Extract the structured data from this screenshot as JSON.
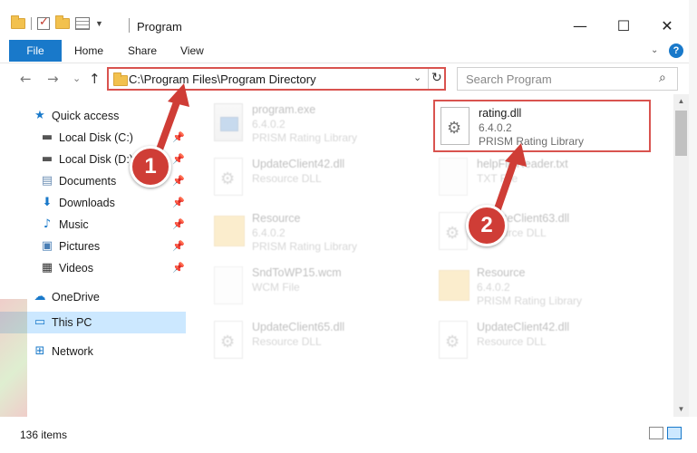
{
  "window": {
    "title": "Program",
    "minimize": "—",
    "maximize": "☐",
    "close": "✕"
  },
  "ribbon": {
    "tabs": [
      "File",
      "Home",
      "Share",
      "View"
    ],
    "help": "?"
  },
  "navbar": {
    "back": "←",
    "forward": "→",
    "recent": "⌄",
    "up": "↑",
    "address": "C:\\Program Files\\Program Directory",
    "refresh": "↻",
    "search_placeholder": "Search Program",
    "search_icon": "⌕"
  },
  "sidebar": {
    "items": [
      {
        "label": "Quick access",
        "icon": "star-icon"
      },
      {
        "label": "Local Disk (C:)",
        "icon": "drive-icon",
        "pinned": true
      },
      {
        "label": "Local Disk (D:)",
        "icon": "drive-icon",
        "pinned": true
      },
      {
        "label": "Documents",
        "icon": "documents-icon",
        "pinned": true
      },
      {
        "label": "Downloads",
        "icon": "download-icon",
        "pinned": true
      },
      {
        "label": "Music",
        "icon": "music-icon",
        "pinned": true
      },
      {
        "label": "Pictures",
        "icon": "pictures-icon",
        "pinned": true
      },
      {
        "label": "Videos",
        "icon": "videos-icon",
        "pinned": true
      },
      {
        "label": "OneDrive",
        "icon": "cloud-icon"
      },
      {
        "label": "This PC",
        "icon": "computer-icon",
        "selected": true
      },
      {
        "label": "Network",
        "icon": "network-icon"
      }
    ]
  },
  "files": [
    {
      "name": "program.exe",
      "line2": "6.4.0.2",
      "line3": "PRISM Rating Library",
      "type": "exe",
      "faded": true
    },
    {
      "name": "rating.dll",
      "line2": "6.4.0.2",
      "line3": "PRISM Rating Library",
      "type": "dll",
      "faded": false
    },
    {
      "name": "UpdateClient42.dll",
      "line2": "Resource DLL",
      "line3": "",
      "type": "dll",
      "faded": true
    },
    {
      "name": "helpFileReader.txt",
      "line2": "TXT File",
      "line3": "",
      "type": "txt",
      "faded": true
    },
    {
      "name": "Resource",
      "line2": "6.4.0.2",
      "line3": "PRISM Rating Library",
      "type": "folder",
      "faded": true
    },
    {
      "name": "UpdateClient63.dll",
      "line2": "Resource DLL",
      "line3": "",
      "type": "dll",
      "faded": true
    },
    {
      "name": "SndToWP15.wcm",
      "line2": "WCM File",
      "line3": "",
      "type": "txt",
      "faded": true
    },
    {
      "name": "Resource",
      "line2": "6.4.0.2",
      "line3": "PRISM Rating Library",
      "type": "folder",
      "faded": true
    },
    {
      "name": "UpdateClient65.dll",
      "line2": "Resource DLL",
      "line3": "",
      "type": "dll",
      "faded": true
    },
    {
      "name": "UpdateClient42.dll",
      "line2": "Resource DLL",
      "line3": "",
      "type": "dll",
      "faded": true
    }
  ],
  "status": {
    "items": "136 items"
  },
  "callouts": {
    "one": "1",
    "two": "2"
  },
  "colors": {
    "accent": "#1979ca",
    "highlight": "#d9534f",
    "callout": "#cf3d36",
    "selected_bg": "#cce8ff"
  }
}
